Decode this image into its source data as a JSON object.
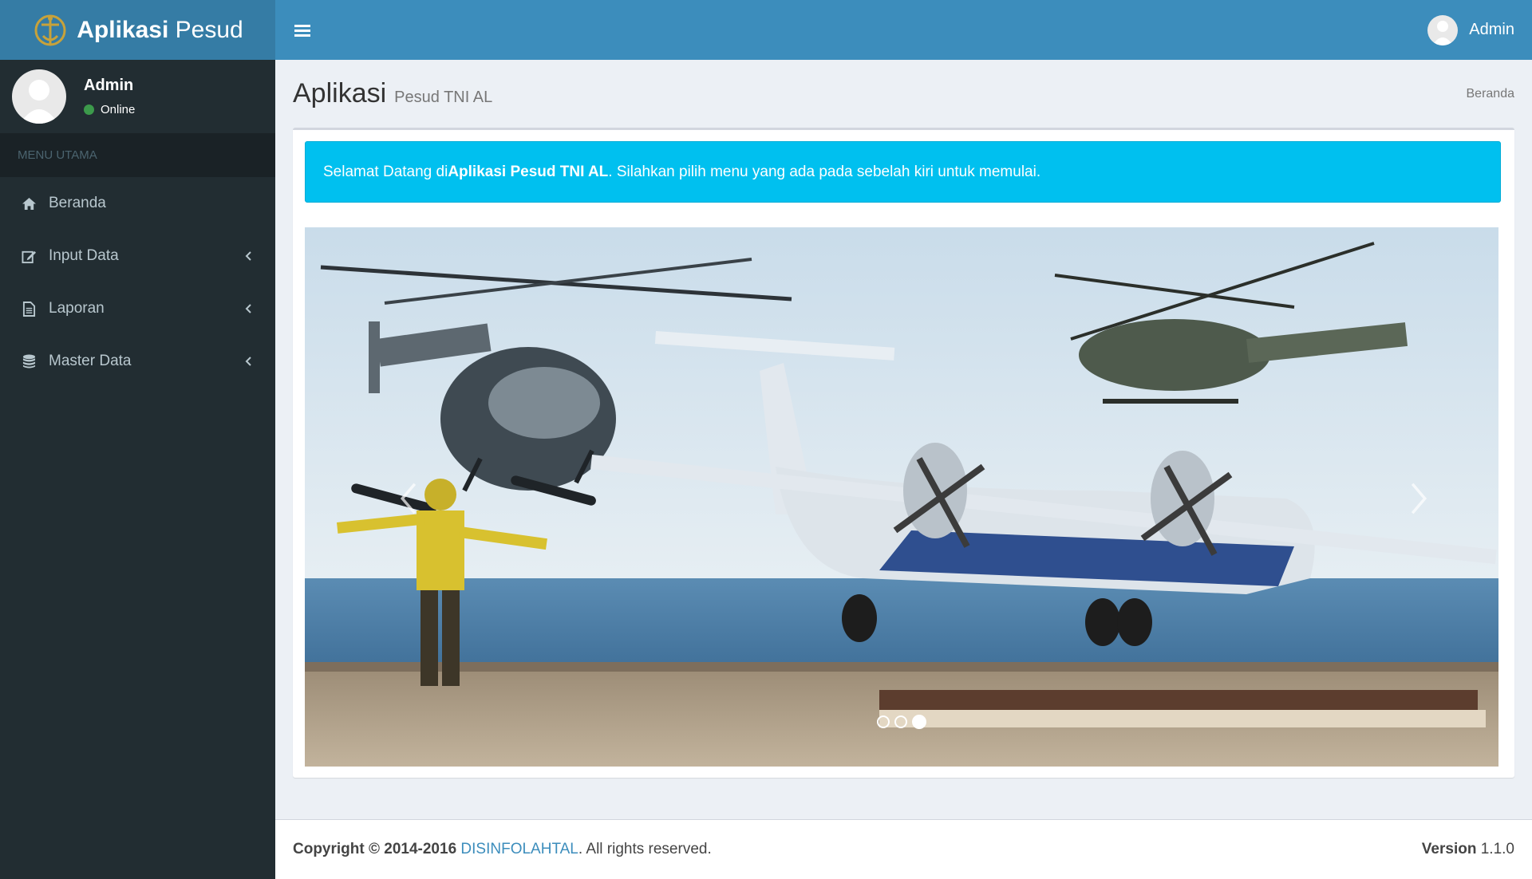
{
  "app": {
    "logo_bold": "Aplikasi",
    "logo_light": "Pesud"
  },
  "navbar": {
    "user_name": "Admin"
  },
  "sidebar": {
    "user_name": "Admin",
    "status": "Online",
    "menu_header": "MENU UTAMA",
    "items": [
      {
        "label": "Beranda",
        "icon": "home-icon"
      },
      {
        "label": "Input Data",
        "icon": "edit-icon"
      },
      {
        "label": "Laporan",
        "icon": "document-icon"
      },
      {
        "label": "Master Data",
        "icon": "database-icon"
      }
    ]
  },
  "page": {
    "title": "Aplikasi",
    "subtitle": "Pesud TNI AL",
    "breadcrumb": "Beranda"
  },
  "alert": {
    "prefix": "Selamat Datang di ",
    "strong": "Aplikasi Pesud TNI AL",
    "suffix": ". Silahkan pilih menu yang ada pada sebelah kiri untuk memulai."
  },
  "carousel": {
    "slide_count": 3,
    "active_index": 2
  },
  "footer": {
    "copyright": "Copyright © 2014-2016 ",
    "org": "DISINFOLAHTAL",
    "rights": ". All rights reserved.",
    "version_label": "Version",
    "version_value": "1.1.0"
  },
  "colors": {
    "header": "#3c8dbc",
    "logo_bg": "#357ca5",
    "sidebar": "#222d32",
    "alert": "#00c0ef",
    "online": "#3c9a4b"
  }
}
